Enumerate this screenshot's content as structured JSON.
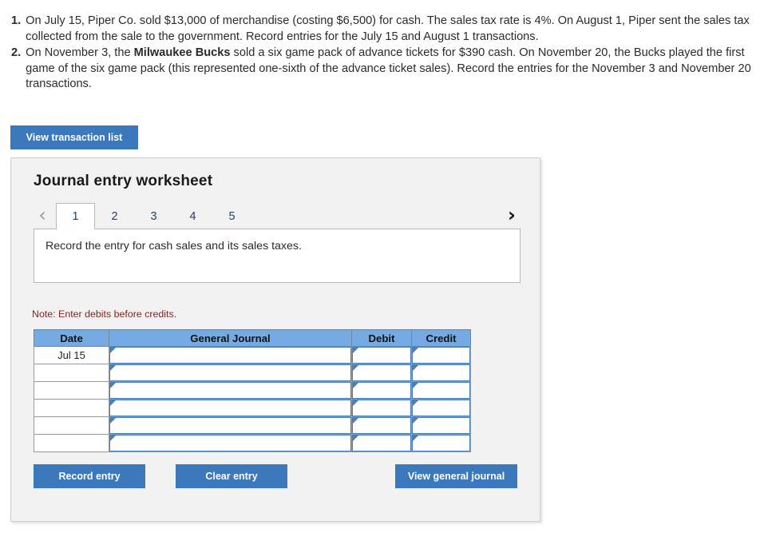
{
  "problems": [
    {
      "number": "1.",
      "parts": [
        {
          "text": "On July 15, Piper Co. sold $13,000 of merchandise (costing $6,500) for cash. The sales tax rate is 4%. On August 1, Piper sent the sales tax collected from the sale to the government. Record entries for the July 15 and August 1 transactions.",
          "bold": false
        }
      ]
    },
    {
      "number": "2.",
      "parts": [
        {
          "text": "On November 3, the ",
          "bold": false
        },
        {
          "text": "Milwaukee Bucks",
          "bold": true
        },
        {
          "text": " sold a six game pack of advance tickets for $390 cash. On November 20, the Bucks played the first game of the six game pack (this represented one-sixth of the advance ticket sales). Record the entries for the November 3 and November 20 transactions.",
          "bold": false
        }
      ]
    }
  ],
  "toolbar": {
    "view_transaction_list_label": "View transaction list"
  },
  "worksheet": {
    "title": "Journal entry worksheet",
    "tabs": [
      {
        "label": "1",
        "active": true
      },
      {
        "label": "2",
        "active": false
      },
      {
        "label": "3",
        "active": false
      },
      {
        "label": "4",
        "active": false
      },
      {
        "label": "5",
        "active": false
      }
    ],
    "prev_icon": "‹",
    "next_icon": "›",
    "instruction": "Record the entry for cash sales and its sales taxes.",
    "note": "Note: Enter debits before credits.",
    "table": {
      "headers": [
        "Date",
        "General Journal",
        "Debit",
        "Credit"
      ],
      "rows": [
        {
          "date": "Jul 15",
          "general_journal": "",
          "debit": "",
          "credit": ""
        },
        {
          "date": "",
          "general_journal": "",
          "debit": "",
          "credit": ""
        },
        {
          "date": "",
          "general_journal": "",
          "debit": "",
          "credit": ""
        },
        {
          "date": "",
          "general_journal": "",
          "debit": "",
          "credit": ""
        },
        {
          "date": "",
          "general_journal": "",
          "debit": "",
          "credit": ""
        },
        {
          "date": "",
          "general_journal": "",
          "debit": "",
          "credit": ""
        }
      ]
    },
    "actions": {
      "record_entry_label": "Record entry",
      "clear_entry_label": "Clear entry",
      "view_general_journal_label": "View general journal"
    }
  },
  "colors": {
    "button_blue": "#3c78bc",
    "table_header_blue": "#75aae2",
    "input_border_blue": "#4a7fb5",
    "note_red": "#8a2121",
    "panel_bg": "#f2f2f2"
  }
}
